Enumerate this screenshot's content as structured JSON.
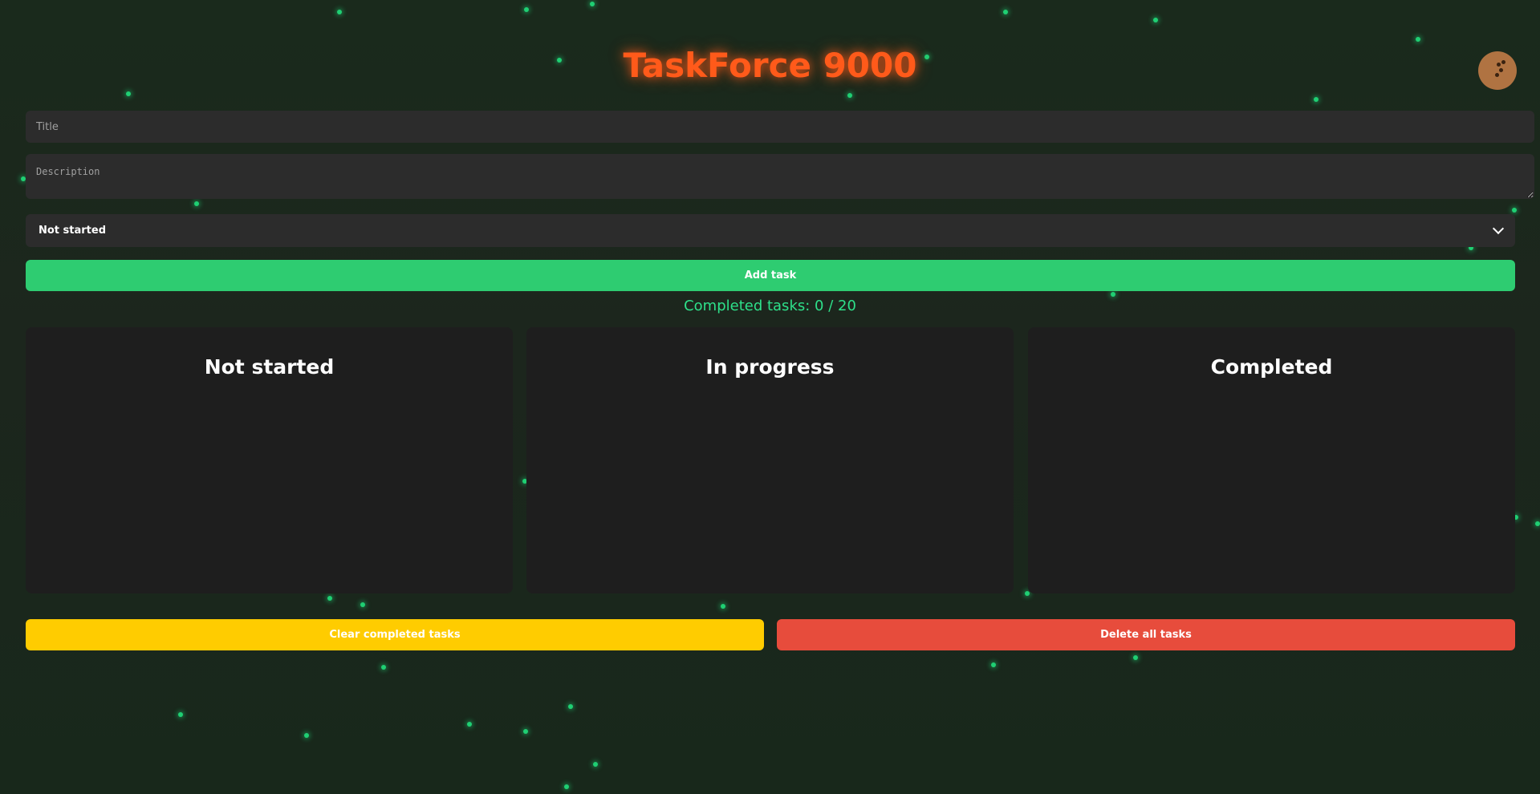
{
  "app": {
    "title": "TaskForce 9000",
    "cookie_icon": "cookie-icon"
  },
  "form": {
    "title_placeholder": "Title",
    "title_value": "",
    "description_placeholder": "Description",
    "description_value": "",
    "status_selected": "Not started",
    "add_button_label": "Add task"
  },
  "stats": {
    "completed_text": "Completed tasks: 0 / 20"
  },
  "columns": [
    {
      "title": "Not started"
    },
    {
      "title": "In progress"
    },
    {
      "title": "Completed"
    }
  ],
  "actions": {
    "clear_completed_label": "Clear completed tasks",
    "delete_all_label": "Delete all tasks"
  },
  "colors": {
    "title": "#ff5a1a",
    "add_button": "#2ecc71",
    "clear_button": "#ffcc00",
    "delete_button": "#e74c3c",
    "counter": "#2ee08a",
    "particles": "#1fcf73"
  }
}
